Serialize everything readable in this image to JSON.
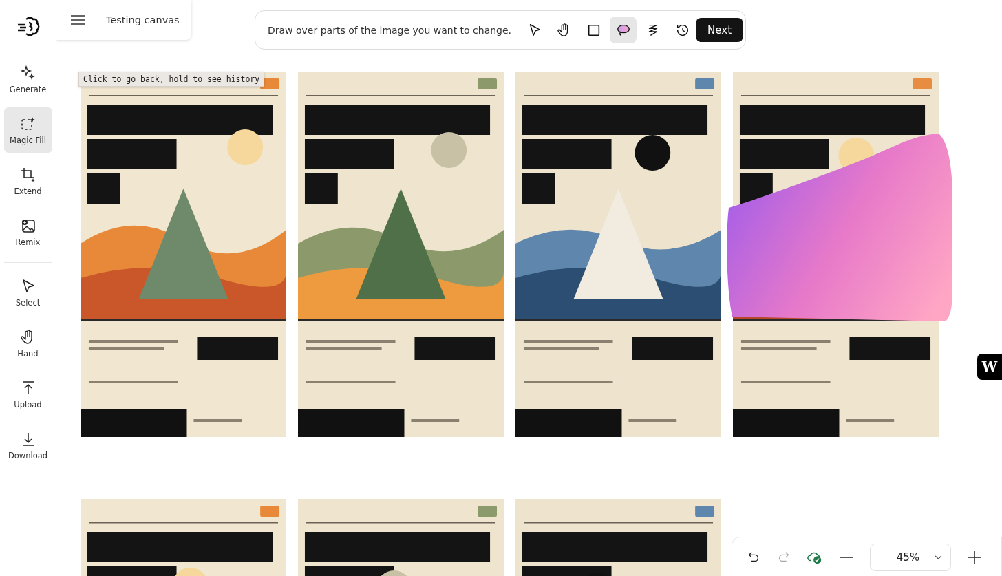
{
  "header": {
    "title": "Testing canvas"
  },
  "sidebar": {
    "groups": [
      [
        {
          "label": "Generate",
          "selected": false
        },
        {
          "label": "Magic Fill",
          "selected": true
        },
        {
          "label": "Extend",
          "selected": false
        },
        {
          "label": "Remix",
          "selected": false
        }
      ],
      [
        {
          "label": "Select",
          "selected": false
        },
        {
          "label": "Hand",
          "selected": false
        },
        {
          "label": "Upload",
          "selected": false
        },
        {
          "label": "Download",
          "selected": false
        }
      ]
    ]
  },
  "toolbar": {
    "hint": "Draw over parts of the image you want to change.",
    "tools": [
      {
        "selected": false
      },
      {
        "selected": false
      },
      {
        "selected": false
      },
      {
        "selected": true
      },
      {
        "selected": false
      },
      {
        "selected": false
      }
    ],
    "next": "Next"
  },
  "tooltip": "Click to go back, hold to see history",
  "canvas": {
    "posters": [
      {
        "kind": "picture",
        "masked": false
      },
      {
        "kind": "picture",
        "masked": false
      },
      {
        "kind": "picture",
        "masked": false
      },
      {
        "kind": "picture",
        "masked": true
      },
      {
        "kind": "picture",
        "masked": false
      },
      {
        "kind": "picture",
        "masked": false
      },
      {
        "kind": "picture",
        "masked": false
      }
    ]
  },
  "side_badge": "W",
  "bottom_bar": {
    "redo_disabled": true,
    "zoom": "45%"
  }
}
